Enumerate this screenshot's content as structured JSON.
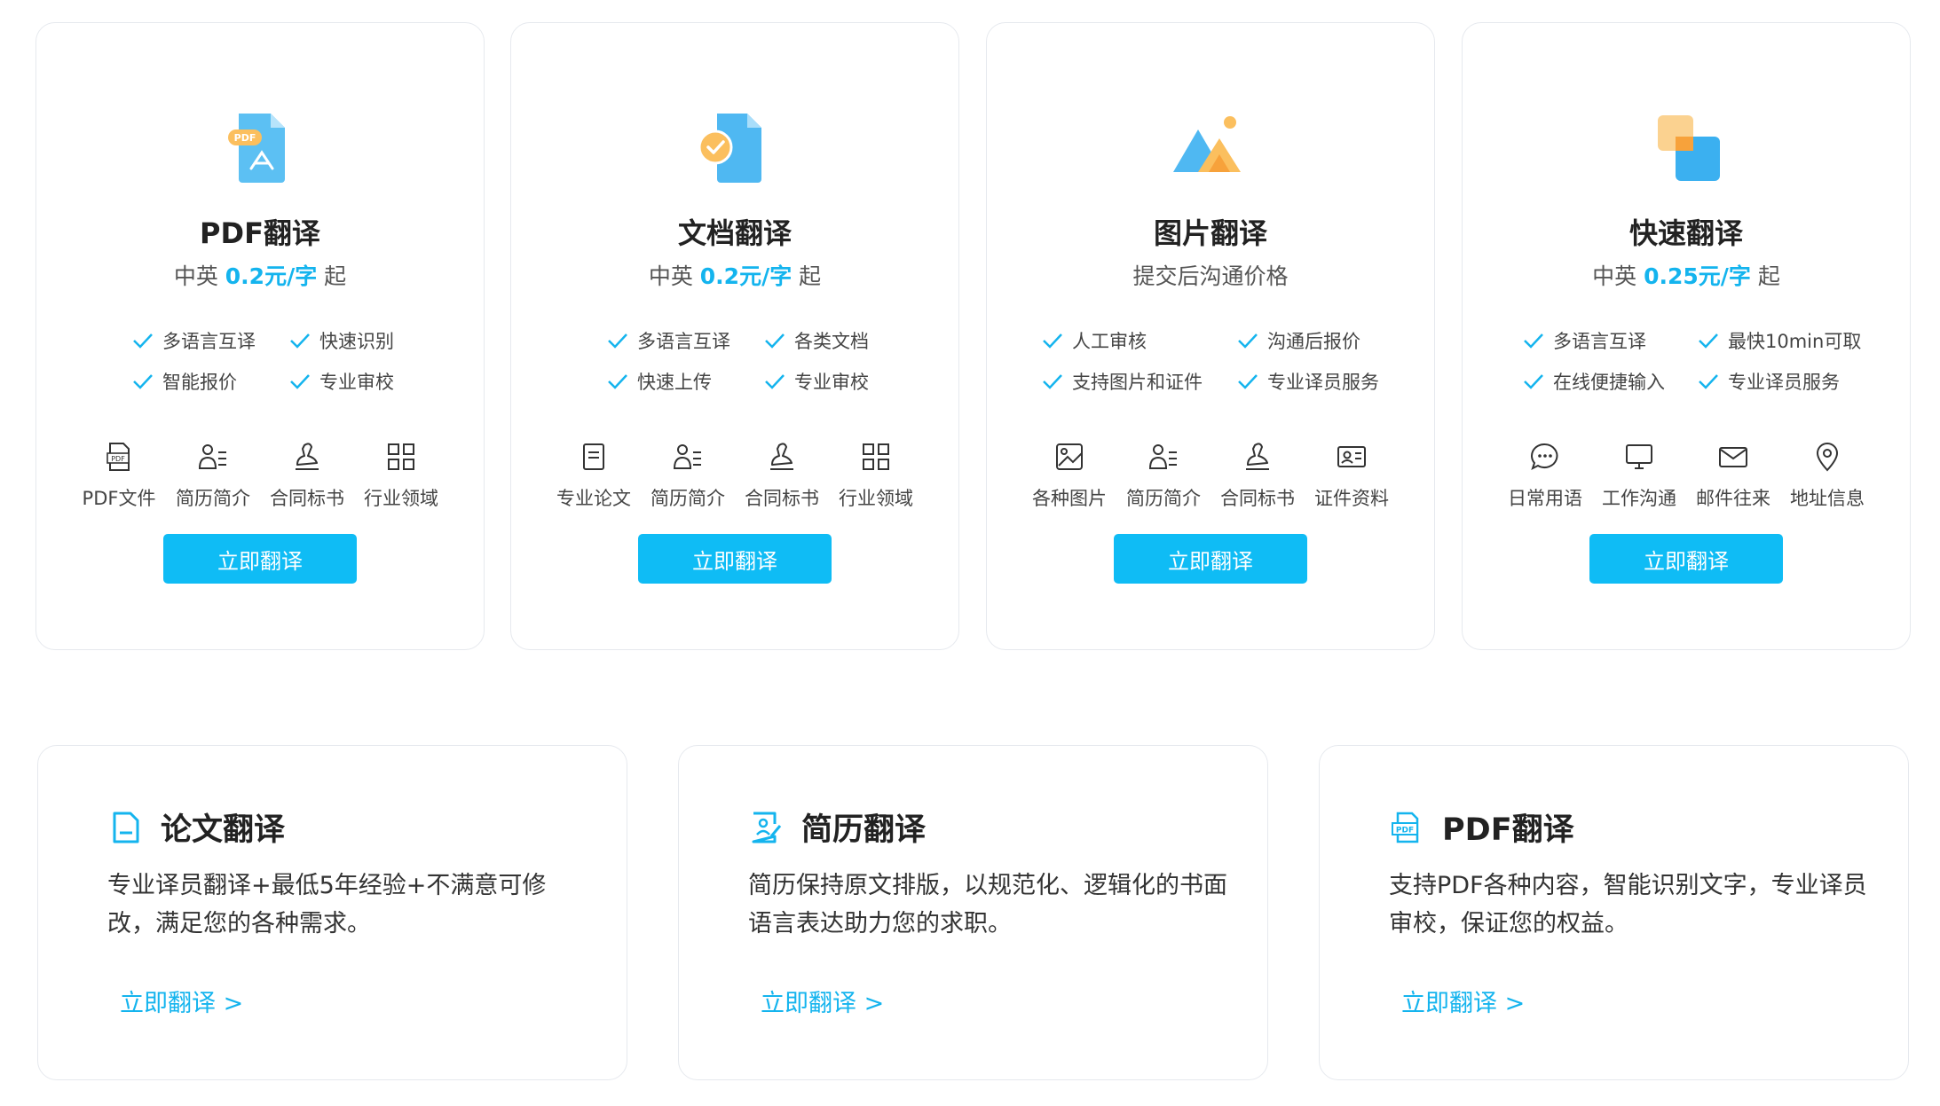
{
  "colors": {
    "accent": "#0fbcf5",
    "price": "#14b4ee",
    "border": "#e6e9ee"
  },
  "top_cards": [
    {
      "hero_icon": "pdf-file-icon",
      "title": "PDF翻译",
      "price_prefix": "中英",
      "price_value": "0.2元/字",
      "price_suffix": "起",
      "features": [
        "多语言互译",
        "快速识别",
        "智能报价",
        "专业审校"
      ],
      "uses": [
        {
          "icon": "pdf-icon",
          "label": "PDF文件"
        },
        {
          "icon": "resume-icon",
          "label": "简历简介"
        },
        {
          "icon": "stamp-icon",
          "label": "合同标书"
        },
        {
          "icon": "grid-icon",
          "label": "行业领域"
        }
      ],
      "button": "立即翻译"
    },
    {
      "hero_icon": "document-check-icon",
      "title": "文档翻译",
      "price_prefix": "中英",
      "price_value": "0.2元/字",
      "price_suffix": "起",
      "features": [
        "多语言互译",
        "各类文档",
        "快速上传",
        "专业审校"
      ],
      "uses": [
        {
          "icon": "paper-icon",
          "label": "专业论文"
        },
        {
          "icon": "resume-icon",
          "label": "简历简介"
        },
        {
          "icon": "stamp-icon",
          "label": "合同标书"
        },
        {
          "icon": "grid-icon",
          "label": "行业领域"
        }
      ],
      "button": "立即翻译"
    },
    {
      "hero_icon": "mountain-image-icon",
      "title": "图片翻译",
      "price_text": "提交后沟通价格",
      "features": [
        "人工审核",
        "沟通后报价",
        "支持图片和证件",
        "专业译员服务"
      ],
      "uses": [
        {
          "icon": "image-icon",
          "label": "各种图片"
        },
        {
          "icon": "resume-icon",
          "label": "简历简介"
        },
        {
          "icon": "stamp-icon",
          "label": "合同标书"
        },
        {
          "icon": "id-card-icon",
          "label": "证件资料"
        }
      ],
      "button": "立即翻译"
    },
    {
      "hero_icon": "overlap-squares-icon",
      "title": "快速翻译",
      "price_prefix": "中英",
      "price_value": "0.25元/字",
      "price_suffix": "起",
      "features": [
        "多语言互译",
        "最快10min可取",
        "在线便捷输入",
        "专业译员服务"
      ],
      "uses": [
        {
          "icon": "chat-icon",
          "label": "日常用语"
        },
        {
          "icon": "monitor-icon",
          "label": "工作沟通"
        },
        {
          "icon": "mail-icon",
          "label": "邮件往来"
        },
        {
          "icon": "location-icon",
          "label": "地址信息"
        }
      ],
      "button": "立即翻译"
    }
  ],
  "bottom_cards": [
    {
      "icon": "paper-doc-icon",
      "title": "论文翻译",
      "desc": "专业译员翻译+最低5年经验+不满意可修改，满足您的各种需求。",
      "link": "立即翻译 >"
    },
    {
      "icon": "resume-edit-icon",
      "title": "简历翻译",
      "desc": "简历保持原文排版，以规范化、逻辑化的书面语言表达助力您的求职。",
      "link": "立即翻译 >"
    },
    {
      "icon": "pdf-doc-icon",
      "title": "PDF翻译",
      "desc": "支持PDF各种内容，智能识别文字，专业译员审校，保证您的权益。",
      "link": "立即翻译 >"
    }
  ]
}
